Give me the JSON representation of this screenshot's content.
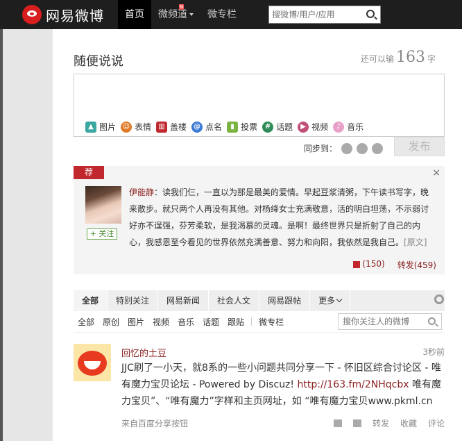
{
  "brand": {
    "name": "网易微博"
  },
  "nav": {
    "items": [
      {
        "label": "首页",
        "active": true
      },
      {
        "label": "微频道",
        "badge": "N"
      },
      {
        "label": "微专栏"
      }
    ]
  },
  "search": {
    "placeholder": "搜微博/用户/应用"
  },
  "composer": {
    "title": "随便说说",
    "remaining_prefix": "还可以输",
    "remaining_count": "163",
    "remaining_suffix": "字",
    "tools": [
      {
        "label": "图片",
        "icon": "image-icon",
        "color": "#3aa7a0"
      },
      {
        "label": "表情",
        "icon": "emoji-icon",
        "color": "#e07b2a"
      },
      {
        "label": "盖楼",
        "icon": "building-icon",
        "color": "#c0282e"
      },
      {
        "label": "点名",
        "icon": "at-icon",
        "color": "#3a7bd5"
      },
      {
        "label": "投票",
        "icon": "vote-icon",
        "color": "#7cb342"
      },
      {
        "label": "话题",
        "icon": "hashtag-icon",
        "color": "#2e8b57"
      },
      {
        "label": "视频",
        "icon": "video-icon",
        "color": "#c0507a"
      },
      {
        "label": "音乐",
        "icon": "music-icon",
        "color": "#e8a0c8"
      }
    ],
    "sync_label": "同步到：",
    "publish_label": "发布"
  },
  "recommend": {
    "badge": "荐",
    "close": "×",
    "follow_label": "+ 关注",
    "username": "伊能静",
    "text": "：读我们仨，一直以为那是最美的爱情。早起豆浆清粥，下午读书写字，晚来散步。就只两个人再没有其他。对杨绛女士充满敬意，活的明白坦荡，不示弱讨好亦不逞强，芬芳柔软，是我渴慕的灵魂。是啊！最终世界只是折射了自己的内心，我感恩至今看见的世界依然充满善意、努力和向阳，我依然是我自己。",
    "original_link": "[原文]",
    "likes": "(150)",
    "repost_label": "转发",
    "repost_count": "(459)"
  },
  "tabs": {
    "items": [
      "全部",
      "特别关注",
      "网易新闻",
      "社会人文",
      "网易跟帖",
      "更多"
    ],
    "active_index": 0
  },
  "subtabs": {
    "items": [
      "全部",
      "原创",
      "图片",
      "视频",
      "音乐",
      "话题",
      "跟贴",
      "微专栏"
    ],
    "search_placeholder": "搜你关注人的微博"
  },
  "post": {
    "username": "回忆的土豆",
    "time": "3秒前",
    "body_before": "JJC刷了一小天，就8系的一些小问题共同分享一下 - 怀旧区综合讨论区 - 唯有魔力宝贝论坛 - Powered by Discuz! ",
    "link": "http://163.fm/2NHqcbx",
    "body_after": " 唯有魔力宝贝”、“唯有魔力”字样和主页网址，如 “唯有魔力宝贝www.pkml.cn",
    "source": "来自百度分享按钮",
    "repost": "转发",
    "favorite": "收藏",
    "comment": "评论"
  }
}
